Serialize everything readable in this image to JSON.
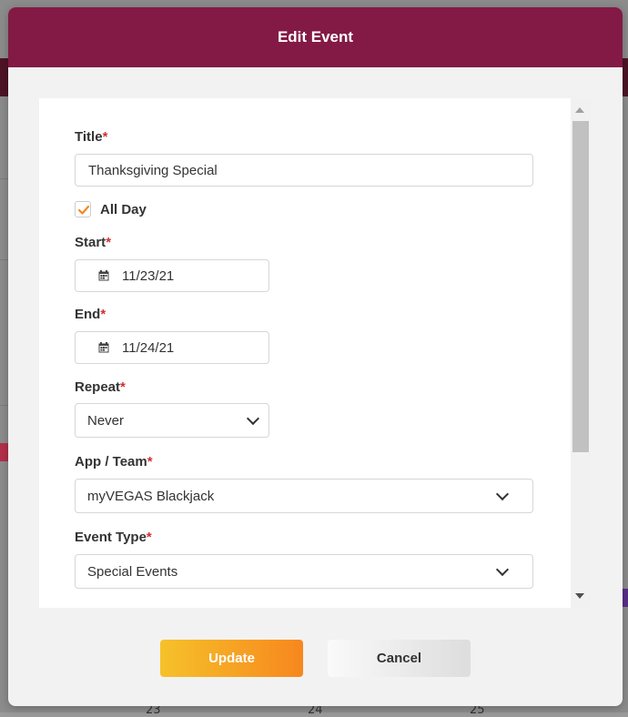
{
  "modal": {
    "title": "Edit Event"
  },
  "form": {
    "title": {
      "label": "Title",
      "required_mark": "*",
      "value": "Thanksgiving Special"
    },
    "all_day": {
      "label": "All Day",
      "checked": true
    },
    "start": {
      "label": "Start",
      "required_mark": "*",
      "value": "11/23/21",
      "icon": "calendar-icon"
    },
    "end": {
      "label": "End",
      "required_mark": "*",
      "value": "11/24/21",
      "icon": "calendar-icon"
    },
    "repeat": {
      "label": "Repeat",
      "required_mark": "*",
      "value": "Never"
    },
    "app_team": {
      "label": "App / Team",
      "required_mark": "*",
      "value": "myVEGAS Blackjack"
    },
    "event_type": {
      "label": "Event Type",
      "required_mark": "*",
      "value": "Special Events"
    }
  },
  "buttons": {
    "update": "Update",
    "cancel": "Cancel"
  },
  "background": {
    "calendar_days": [
      "23",
      "24",
      "25"
    ]
  },
  "colors": {
    "header": "#831a45",
    "required": "#d32f2f",
    "checkbox_check": "#f7871e",
    "update_gradient_start": "#f6c12a",
    "update_gradient_end": "#f7871e"
  }
}
